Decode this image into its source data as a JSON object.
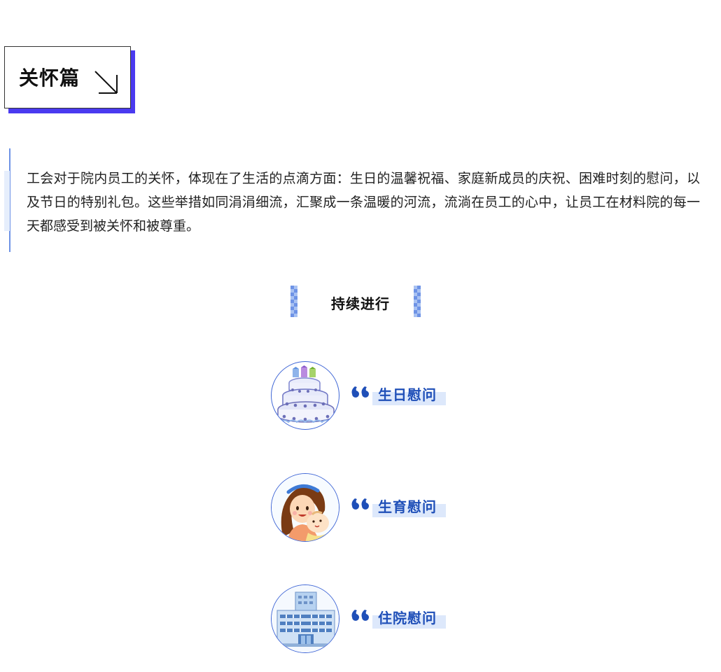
{
  "section": {
    "title": "关怀篇"
  },
  "intro": {
    "text": "工会对于院内员工的关怀，体现在了生活的点滴方面：生日的温馨祝福、家庭新成员的庆祝、困难时刻的慰问，以及节日的特别礼包。这些举措如同涓涓细流，汇聚成一条温暖的河流，流淌在员工的心中，让员工在材料院的每一天都感受到被关怀和被尊重。"
  },
  "subheading": {
    "title": "持续进行"
  },
  "items": [
    {
      "label": "生日慰问",
      "icon": "birthday-cake-icon"
    },
    {
      "label": "生育慰问",
      "icon": "mother-baby-icon"
    },
    {
      "label": "住院慰问",
      "icon": "hospital-icon"
    }
  ],
  "colors": {
    "accent": "#4a3af0",
    "label_blue": "#1f4fb8",
    "label_bg": "#dde8fb",
    "rule": "#6e93e6"
  }
}
